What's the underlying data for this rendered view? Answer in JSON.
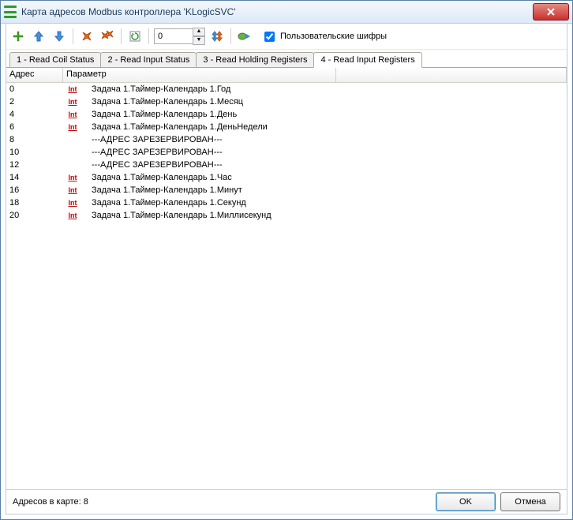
{
  "window": {
    "title": "Карта адресов Modbus контроллера 'KLogicSVC'"
  },
  "toolbar": {
    "spinner_value": "0",
    "checkbox_label": "Пользовательские шифры",
    "checkbox_checked": true
  },
  "tabs": [
    {
      "label": "1 - Read Coil Status",
      "active": false
    },
    {
      "label": "2 - Read Input Status",
      "active": false
    },
    {
      "label": "3 - Read Holding Registers",
      "active": false
    },
    {
      "label": "4 - Read Input Registers",
      "active": true
    }
  ],
  "columns": {
    "addr": "Адрес",
    "param": "Параметр"
  },
  "rows": [
    {
      "addr": "0",
      "icon": "int",
      "text": "Задача 1.Таймер-Календарь 1.Год"
    },
    {
      "addr": "2",
      "icon": "int",
      "text": "Задача 1.Таймер-Календарь 1.Месяц"
    },
    {
      "addr": "4",
      "icon": "int",
      "text": "Задача 1.Таймер-Календарь 1.День"
    },
    {
      "addr": "6",
      "icon": "int",
      "text": "Задача 1.Таймер-Календарь 1.ДеньНедели"
    },
    {
      "addr": "8",
      "icon": "",
      "text": "---АДРЕС  ЗАРЕЗЕРВИРОВАН---"
    },
    {
      "addr": "10",
      "icon": "",
      "text": "---АДРЕС  ЗАРЕЗЕРВИРОВАН---"
    },
    {
      "addr": "12",
      "icon": "",
      "text": "---АДРЕС  ЗАРЕЗЕРВИРОВАН---"
    },
    {
      "addr": "14",
      "icon": "int",
      "text": "Задача 1.Таймер-Календарь 1.Час"
    },
    {
      "addr": "16",
      "icon": "int",
      "text": "Задача 1.Таймер-Календарь 1.Минут"
    },
    {
      "addr": "18",
      "icon": "int",
      "text": "Задача 1.Таймер-Календарь 1.Секунд"
    },
    {
      "addr": "20",
      "icon": "int",
      "text": "Задача 1.Таймер-Календарь 1.Миллисекунд"
    }
  ],
  "status": {
    "text": "Адресов в карте: 8"
  },
  "buttons": {
    "ok": "OK",
    "cancel": "Отмена"
  }
}
